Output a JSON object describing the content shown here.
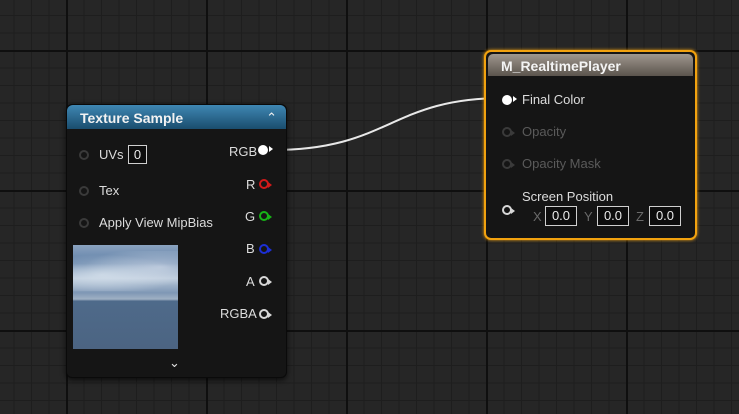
{
  "texture_sample": {
    "title": "Texture Sample",
    "inputs": [
      {
        "label": "UVs",
        "value": "0"
      },
      {
        "label": "Tex"
      },
      {
        "label": "Apply View MipBias"
      }
    ],
    "outputs": [
      "RGB",
      "R",
      "G",
      "B",
      "A",
      "RGBA"
    ]
  },
  "material_node": {
    "title": "M_RealtimePlayer",
    "inputs": [
      {
        "label": "Final Color",
        "connected": true
      },
      {
        "label": "Opacity",
        "enabled": false
      },
      {
        "label": "Opacity Mask",
        "enabled": false
      },
      {
        "label": "Screen Position",
        "enabled": true
      }
    ],
    "screen_position": {
      "x_label": "X",
      "x_value": "0.0",
      "y_label": "Y",
      "y_value": "0.0",
      "z_label": "Z",
      "z_value": "0.0"
    }
  },
  "colors": {
    "selection_outline": "#f2a20f",
    "texture_header": "#2a6a92",
    "material_header": "#7a736b",
    "pin_r": "#d11a1a",
    "pin_g": "#17b317",
    "pin_b": "#1c2fd6"
  },
  "connection": {
    "from": "RGB",
    "to": "Final Color"
  }
}
